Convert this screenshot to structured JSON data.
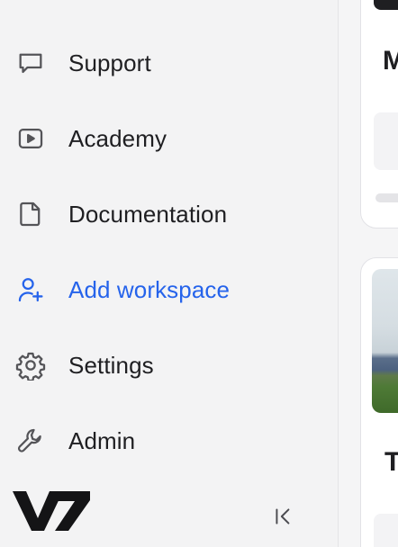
{
  "sidebar": {
    "items": [
      {
        "label": "Support",
        "icon": "chat-bubble-icon"
      },
      {
        "label": "Academy",
        "icon": "play-icon"
      },
      {
        "label": "Documentation",
        "icon": "document-icon"
      },
      {
        "label": "Add workspace",
        "icon": "add-user-icon",
        "accent": "#2563eb"
      },
      {
        "label": "Settings",
        "icon": "gear-icon"
      },
      {
        "label": "Admin",
        "icon": "wrench-icon"
      }
    ],
    "logo": "V7",
    "collapse_icon": "collapse-sidebar-icon"
  },
  "main": {
    "cards": [
      {
        "title_partial": "M"
      },
      {
        "title_partial": "T"
      }
    ]
  },
  "colors": {
    "accent": "#2563eb",
    "text": "#1f1f22",
    "sidebar_bg": "#f3f3f4"
  }
}
